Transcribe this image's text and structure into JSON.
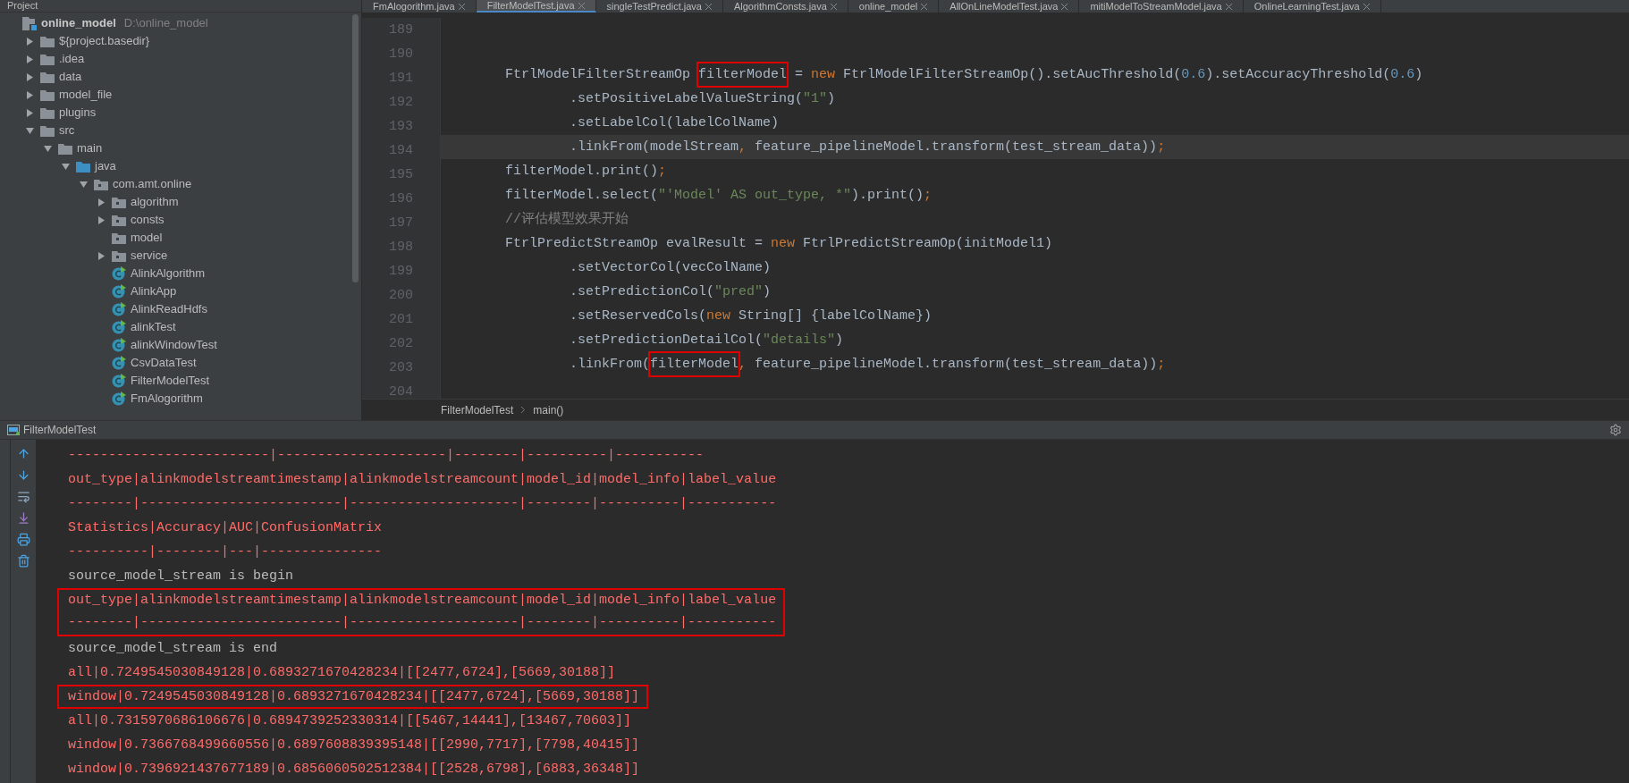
{
  "project_panel": {
    "title": "Project",
    "tree": [
      {
        "label": "online_model",
        "path": "D:\\online_model",
        "kind": "module",
        "children": [
          {
            "label": "${project.basedir}",
            "kind": "folder",
            "expanded": false
          },
          {
            "label": ".idea",
            "kind": "folder",
            "expanded": false
          },
          {
            "label": "data",
            "kind": "folder",
            "expanded": false
          },
          {
            "label": "model_file",
            "kind": "folder",
            "expanded": false
          },
          {
            "label": "plugins",
            "kind": "folder",
            "expanded": false
          },
          {
            "label": "src",
            "kind": "folder",
            "expanded": true,
            "children": [
              {
                "label": "main",
                "kind": "folder",
                "expanded": true,
                "children": [
                  {
                    "label": "java",
                    "kind": "source",
                    "expanded": true,
                    "children": [
                      {
                        "label": "com.amt.online",
                        "kind": "package",
                        "expanded": true,
                        "children": [
                          {
                            "label": "algorithm",
                            "kind": "package",
                            "expanded": false
                          },
                          {
                            "label": "consts",
                            "kind": "package",
                            "expanded": false
                          },
                          {
                            "label": "model",
                            "kind": "leafpackage"
                          },
                          {
                            "label": "service",
                            "kind": "package",
                            "expanded": false
                          },
                          {
                            "label": "AlinkAlgorithm",
                            "kind": "class"
                          },
                          {
                            "label": "AlinkApp",
                            "kind": "class"
                          },
                          {
                            "label": "AlinkReadHdfs",
                            "kind": "class"
                          },
                          {
                            "label": "alinkTest",
                            "kind": "class"
                          },
                          {
                            "label": "alinkWindowTest",
                            "kind": "class"
                          },
                          {
                            "label": "CsvDataTest",
                            "kind": "class"
                          },
                          {
                            "label": "FilterModelTest",
                            "kind": "class"
                          },
                          {
                            "label": "FmAlogorithm",
                            "kind": "class"
                          }
                        ]
                      }
                    ]
                  }
                ]
              }
            ]
          }
        ]
      }
    ]
  },
  "tabs": [
    {
      "label": "FmAlogorithm.java",
      "selected": false
    },
    {
      "label": "FilterModelTest.java",
      "selected": true
    },
    {
      "label": "singleTestPredict.java",
      "selected": false
    },
    {
      "label": "AlgorithmConsts.java",
      "selected": false
    },
    {
      "label": "online_model",
      "selected": false
    },
    {
      "label": "AllOnLineModelTest.java",
      "selected": false
    },
    {
      "label": "mitiModelToStreamModel.java",
      "selected": false
    },
    {
      "label": "OnlineLearningTest.java",
      "selected": false
    }
  ],
  "editor": {
    "lines": [
      {
        "number": "189"
      },
      {
        "number": "190"
      },
      {
        "number": "191",
        "continuation": false,
        "current": false,
        "tokens": [
          {
            "kind": "plain",
            "text": "FtrlModelFilterStreamOp "
          },
          {
            "kind": "plain",
            "text": "filterModel",
            "boxed": true
          },
          {
            "kind": "plain",
            "text": " = "
          },
          {
            "kind": "keyword",
            "text": "new"
          },
          {
            "kind": "plain",
            "text": " FtrlModelFilterStreamOp().setAucThreshold("
          },
          {
            "kind": "number",
            "text": "0.6"
          },
          {
            "kind": "plain",
            "text": ").setAccuracyThreshold("
          },
          {
            "kind": "number",
            "text": "0.6"
          },
          {
            "kind": "plain",
            "text": ")"
          }
        ]
      },
      {
        "number": "192",
        "continuation": true,
        "current": false,
        "tokens": [
          {
            "kind": "plain",
            "text": ".setPositiveLabelValueString("
          },
          {
            "kind": "string",
            "text": "\"1\""
          },
          {
            "kind": "plain",
            "text": ")"
          }
        ]
      },
      {
        "number": "193",
        "continuation": true,
        "current": false,
        "tokens": [
          {
            "kind": "plain",
            "text": ".setLabelCol(labelColName)"
          }
        ]
      },
      {
        "number": "194",
        "continuation": true,
        "current": true,
        "tokens": [
          {
            "kind": "plain",
            "text": ".linkFrom(modelStream"
          },
          {
            "kind": "keyword",
            "text": ","
          },
          {
            "kind": "plain",
            "text": " feature_pipelineModel.transform(test_stream_data))"
          },
          {
            "kind": "keyword",
            "text": ";"
          }
        ]
      },
      {
        "number": "195",
        "continuation": false,
        "current": false,
        "tokens": [
          {
            "kind": "plain",
            "text": "filterModel.print()"
          },
          {
            "kind": "keyword",
            "text": ";"
          }
        ]
      },
      {
        "number": "196",
        "continuation": false,
        "current": false,
        "tokens": [
          {
            "kind": "plain",
            "text": "filterModel.select("
          },
          {
            "kind": "string",
            "text": "\"'Model' AS out_type, *\""
          },
          {
            "kind": "plain",
            "text": ").print()"
          },
          {
            "kind": "keyword",
            "text": ";"
          }
        ]
      },
      {
        "number": "197",
        "continuation": false,
        "current": false,
        "tokens": [
          {
            "kind": "comment",
            "text": "//评估模型效果开始"
          }
        ]
      },
      {
        "number": "198",
        "continuation": false,
        "current": false,
        "tokens": [
          {
            "kind": "plain",
            "text": "FtrlPredictStreamOp evalResult = "
          },
          {
            "kind": "keyword",
            "text": "new"
          },
          {
            "kind": "plain",
            "text": " FtrlPredictStreamOp(initModel1)"
          }
        ]
      },
      {
        "number": "199",
        "continuation": true,
        "current": false,
        "tokens": [
          {
            "kind": "plain",
            "text": ".setVectorCol(vecColName)"
          }
        ]
      },
      {
        "number": "200",
        "continuation": true,
        "current": false,
        "tokens": [
          {
            "kind": "plain",
            "text": ".setPredictionCol("
          },
          {
            "kind": "string",
            "text": "\"pred\""
          },
          {
            "kind": "plain",
            "text": ")"
          }
        ]
      },
      {
        "number": "201",
        "continuation": true,
        "current": false,
        "tokens": [
          {
            "kind": "plain",
            "text": ".setReservedCols("
          },
          {
            "kind": "keyword",
            "text": "new"
          },
          {
            "kind": "plain",
            "text": " String[] {labelColName})"
          }
        ]
      },
      {
        "number": "202",
        "continuation": true,
        "current": false,
        "tokens": [
          {
            "kind": "plain",
            "text": ".setPredictionDetailCol("
          },
          {
            "kind": "string",
            "text": "\"details\""
          },
          {
            "kind": "plain",
            "text": ")"
          }
        ]
      },
      {
        "number": "203",
        "continuation": true,
        "current": false,
        "tokens": [
          {
            "kind": "plain",
            "text": ".linkFrom("
          },
          {
            "kind": "plain",
            "text": "filterModel",
            "boxed": true
          },
          {
            "kind": "keyword",
            "text": ","
          },
          {
            "kind": "plain",
            "text": " feature_pipelineModel.transform(test_stream_data))"
          },
          {
            "kind": "keyword",
            "text": ";"
          }
        ]
      },
      {
        "number": "204"
      }
    ],
    "breadcrumb": [
      "FilterModelTest",
      "main()"
    ]
  },
  "run_panel": {
    "title": "FilterModelTest",
    "console": [
      {
        "kind": "error",
        "text": "-------------------------|---------------------|--------|----------|-----------",
        "boxed": false
      },
      {
        "kind": "error",
        "text": "out_type|alinkmodelstreamtimestamp|alinkmodelstreamcount|model_id|model_info|label_value",
        "boxed": false
      },
      {
        "kind": "error",
        "text": "--------|-------------------------|---------------------|--------|----------|-----------",
        "boxed": false
      },
      {
        "kind": "error",
        "text": "Statistics|Accuracy|AUC|ConfusionMatrix",
        "boxed": false
      },
      {
        "kind": "error",
        "text": "----------|--------|---|---------------",
        "boxed": false
      },
      {
        "kind": "output",
        "text": "source_model_stream is begin",
        "boxed": false
      },
      {
        "kind": "error",
        "text": "out_type|alinkmodelstreamtimestamp|alinkmodelstreamcount|model_id|model_info|label_value",
        "boxed": true
      },
      {
        "kind": "error",
        "text": "--------|-------------------------|---------------------|--------|----------|-----------",
        "boxed": true
      },
      {
        "kind": "output",
        "text": "source_model_stream is end",
        "boxed": false
      },
      {
        "kind": "error",
        "text": "all|0.7249545030849128|0.6893271670428234|[[2477,6724],[5669,30188]]",
        "boxed": false
      },
      {
        "kind": "error",
        "text": "window|0.7249545030849128|0.6893271670428234|[[2477,6724],[5669,30188]]",
        "boxed": true
      },
      {
        "kind": "error",
        "text": "all|0.7315970686106676|0.6894739252330314|[[5467,14441],[13467,70603]]",
        "boxed": false
      },
      {
        "kind": "error",
        "text": "window|0.7366768499660556|0.6897608839395148|[[2990,7717],[7798,40415]]",
        "boxed": false
      },
      {
        "kind": "error",
        "text": "window|0.7396921437677189|0.6856060502512384|[[2528,6798],[6883,36348]]",
        "boxed": false
      }
    ]
  }
}
